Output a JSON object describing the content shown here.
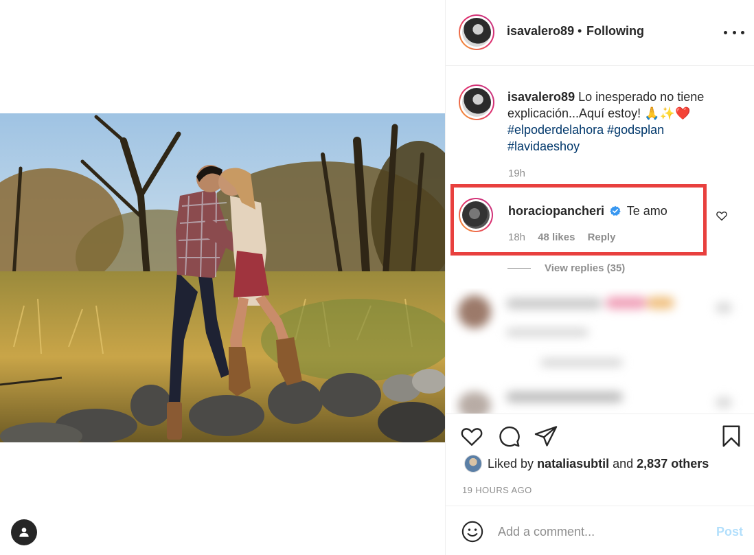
{
  "post": {
    "author": "isavalero89",
    "follow_status": "Following",
    "separator": "•"
  },
  "caption": {
    "username": "isavalero89",
    "text": "Lo inesperado no tiene explicación...Aquí estoy!",
    "emojis": "🙏✨❤️",
    "hashtags": "#elpoderdelahora #godsplan #lavidaeshoy",
    "time": "19h"
  },
  "comment": {
    "username": "horacioPancheri",
    "username_display": "horaciopancheri",
    "text": "Te amo",
    "time": "18h",
    "likes": "48 likes",
    "reply_label": "Reply",
    "view_replies": "View replies (35)"
  },
  "likes": {
    "prefix": "Liked by",
    "user": "nataliasubtil",
    "joiner": "and",
    "others": "2,837 others"
  },
  "timestamp": "19 HOURS AGO",
  "composer": {
    "placeholder": "Add a comment...",
    "post_label": "Post"
  },
  "colors": {
    "highlight_box": "#e8403e",
    "link": "#00376b",
    "muted": "#8e8e8e",
    "post_disabled": "#b2dffc"
  },
  "icons": [
    "more-options-icon",
    "verified-badge-icon",
    "heart-icon",
    "comment-icon",
    "share-icon",
    "bookmark-icon",
    "emoji-icon",
    "user-tag-icon"
  ]
}
